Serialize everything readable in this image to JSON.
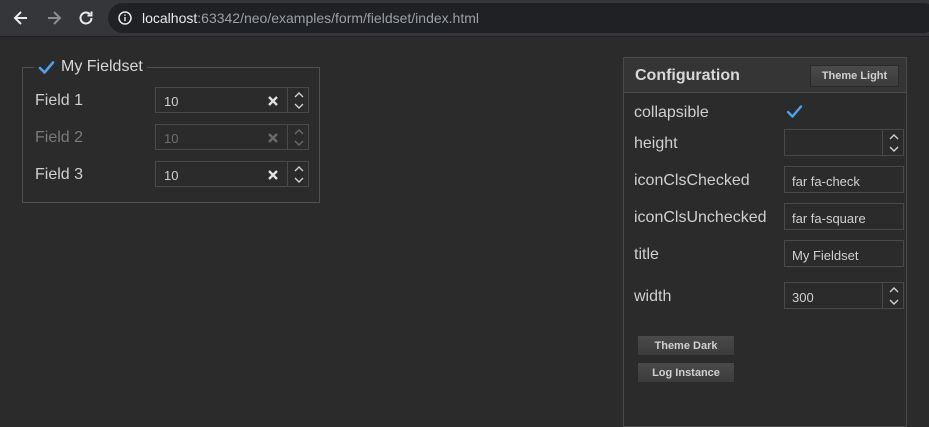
{
  "browser": {
    "url_host": "localhost",
    "url_rest": ":63342/neo/examples/form/fieldset/index.html"
  },
  "fieldset": {
    "title": "My Fieldset",
    "fields": [
      {
        "label": "Field 1",
        "value": "10",
        "disabled": false
      },
      {
        "label": "Field 2",
        "value": "10",
        "disabled": true
      },
      {
        "label": "Field 3",
        "value": "10",
        "disabled": false
      }
    ]
  },
  "config": {
    "title": "Configuration",
    "theme_light_label": "Theme Light",
    "rows": {
      "collapsible": {
        "label": "collapsible",
        "checked": true
      },
      "height": {
        "label": "height",
        "value": ""
      },
      "iconClsChecked": {
        "label": "iconClsChecked",
        "value": "far fa-check"
      },
      "iconClsUnchecked": {
        "label": "iconClsUnchecked",
        "value": "far fa-square"
      },
      "title": {
        "label": "title",
        "value": "My Fieldset"
      },
      "width": {
        "label": "width",
        "value": "300"
      }
    },
    "theme_dark_label": "Theme Dark",
    "log_instance_label": "Log Instance"
  },
  "colors": {
    "accent": "#4aa3f0",
    "background": "#2b2b2b"
  }
}
